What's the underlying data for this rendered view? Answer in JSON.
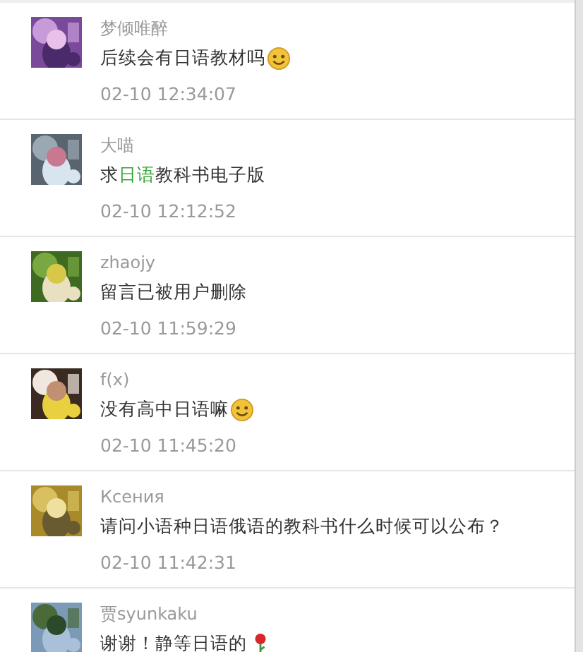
{
  "comments": [
    {
      "author": "梦倾唯醉",
      "parts": [
        {
          "kind": "text",
          "text": "后续会有日语教材吗"
        },
        {
          "kind": "face"
        }
      ],
      "time": "02-10 12:34:07"
    },
    {
      "author": "大喵",
      "parts": [
        {
          "kind": "text",
          "text": "求"
        },
        {
          "kind": "link",
          "text": "日语"
        },
        {
          "kind": "text",
          "text": "教科书电子版"
        }
      ],
      "time": "02-10 12:12:52"
    },
    {
      "author": "zhaojy",
      "parts": [
        {
          "kind": "text",
          "text": "留言已被用户删除"
        }
      ],
      "time": "02-10 11:59:29"
    },
    {
      "author": "f(x)",
      "parts": [
        {
          "kind": "text",
          "text": "没有高中日语嘛"
        },
        {
          "kind": "face"
        }
      ],
      "time": "02-10 11:45:20"
    },
    {
      "author": "Ксения",
      "parts": [
        {
          "kind": "text",
          "text": "请问小语种日语俄语的教科书什么时候可以公布？"
        }
      ],
      "time": "02-10 11:42:31"
    },
    {
      "author": "贾syunkaku",
      "parts": [
        {
          "kind": "text",
          "text": "谢谢！静等日语的"
        },
        {
          "kind": "flower"
        }
      ]
    }
  ]
}
